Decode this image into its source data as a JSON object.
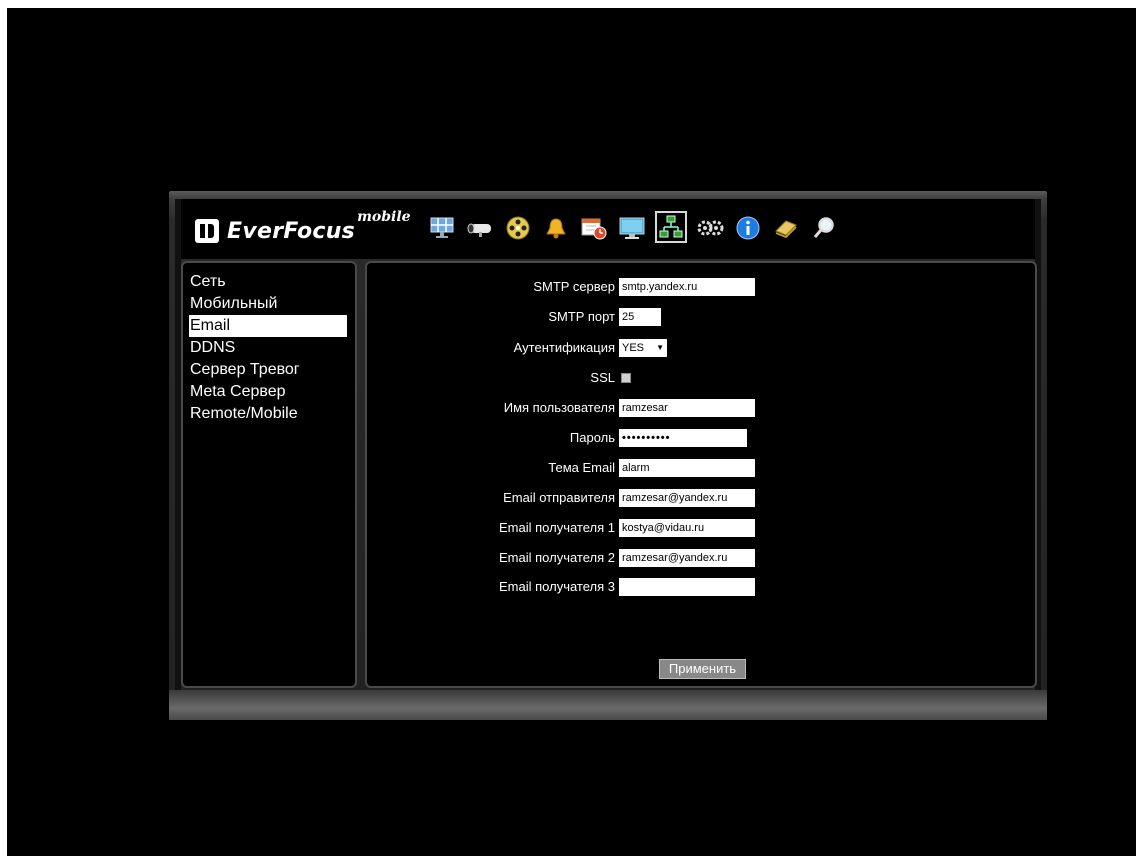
{
  "brand": {
    "name": "EverFocus",
    "suffix": "mobile"
  },
  "toolbar": {
    "icons": [
      "monitor-grid-icon",
      "camera-icon",
      "film-reel-icon",
      "bell-icon",
      "calendar-clock-icon",
      "display-icon",
      "network-icon",
      "gears-icon",
      "info-icon",
      "folder-icon",
      "search-icon"
    ],
    "active": "network-icon"
  },
  "sidebar": {
    "items": [
      {
        "label": "Сеть"
      },
      {
        "label": "Мобильный"
      },
      {
        "label": "Email"
      },
      {
        "label": "DDNS"
      },
      {
        "label": "Сервер Тревог"
      },
      {
        "label": "Meta Сервер"
      },
      {
        "label": "Remote/Mobile"
      }
    ],
    "selected": "Email"
  },
  "form": {
    "smtp_server": {
      "label": "SMTP сервер",
      "value": "smtp.yandex.ru"
    },
    "smtp_port": {
      "label": "SMTP порт",
      "value": "25"
    },
    "auth": {
      "label": "Аутентификация",
      "value": "YES"
    },
    "ssl": {
      "label": "SSL",
      "checked": false
    },
    "username": {
      "label": "Имя пользователя",
      "value": "ramzesar"
    },
    "password": {
      "label": "Пароль",
      "value": "••••••••••"
    },
    "subject": {
      "label": "Тема Email",
      "value": "alarm"
    },
    "sender": {
      "label": "Email отправителя",
      "value": "ramzesar@yandex.ru"
    },
    "recipient1": {
      "label": "Email получателя 1",
      "value": "kostya@vidau.ru"
    },
    "recipient2": {
      "label": "Email получателя 2",
      "value": "ramzesar@yandex.ru"
    },
    "recipient3": {
      "label": "Email получателя 3",
      "value": ""
    },
    "apply_label": "Применить"
  },
  "colors": {
    "background": "#000000",
    "panel_border": "#4a4a4a",
    "selected_bg": "#ffffff",
    "apply_button": "#888888"
  }
}
